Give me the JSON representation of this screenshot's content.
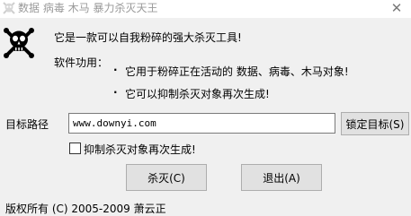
{
  "window": {
    "title": "数据 病毒 木马 暴力杀灭天王",
    "close_glyph": "✕"
  },
  "info": {
    "headline": "它是一款可以自我粉碎的强大杀灭工具!",
    "features_label": "软件功用：",
    "bullet_glyph": "·",
    "feature_1": "它用于粉碎正在活动的 数据、病毒、木马对象!",
    "feature_2": "它可以抑制杀灭对象再次生成!"
  },
  "target": {
    "label": "目标路径",
    "value": "www.downyi.com",
    "lock_button": "锁定目标(S)"
  },
  "option": {
    "checked": false,
    "label": "抑制杀灭对象再次生成!"
  },
  "actions": {
    "kill_button": "杀灭(C)",
    "exit_button": "退出(A)"
  },
  "footer": {
    "copyright": "版权所有 (C) 2005-2009 萧云正"
  }
}
